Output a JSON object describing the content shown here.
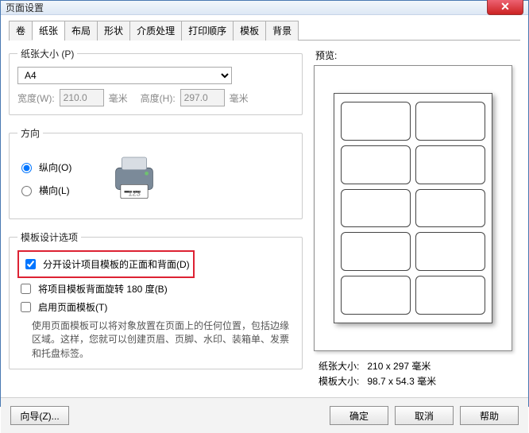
{
  "window": {
    "title": "页面设置"
  },
  "tabs": {
    "items": [
      {
        "label": "卷"
      },
      {
        "label": "纸张"
      },
      {
        "label": "布局"
      },
      {
        "label": "形状"
      },
      {
        "label": "介质处理"
      },
      {
        "label": "打印顺序"
      },
      {
        "label": "模板"
      },
      {
        "label": "背景"
      }
    ],
    "active_index": 1
  },
  "paper_size": {
    "legend": "纸张大小 (P)",
    "selected": "A4",
    "width_label": "宽度(W):",
    "width_value": "210.0",
    "height_label": "高度(H):",
    "height_value": "297.0",
    "unit": "毫米"
  },
  "orientation": {
    "legend": "方向",
    "portrait": "纵向(O)",
    "landscape": "横向(L)",
    "selected": "portrait"
  },
  "template_opts": {
    "legend": "模板设计选项",
    "chk1": "分开设计项目模板的正面和背面(D)",
    "chk1_checked": true,
    "chk2": "将项目模板背面旋转 180 度(B)",
    "chk2_checked": false,
    "chk3": "启用页面模板(T)",
    "chk3_checked": false,
    "desc": "使用页面模板可以将对象放置在页面上的任何位置，包括边缘区域。这样，您就可以创建页眉、页脚、水印、装箱单、发票和托盘标签。"
  },
  "preview": {
    "label": "预览:",
    "paper_size_label": "纸张大小:",
    "paper_size_value": "210 x 297 毫米",
    "template_size_label": "模板大小:",
    "template_size_value": "98.7 x 54.3 毫米"
  },
  "footer": {
    "wizard": "向导(Z)...",
    "ok": "确定",
    "cancel": "取消",
    "help": "帮助"
  }
}
